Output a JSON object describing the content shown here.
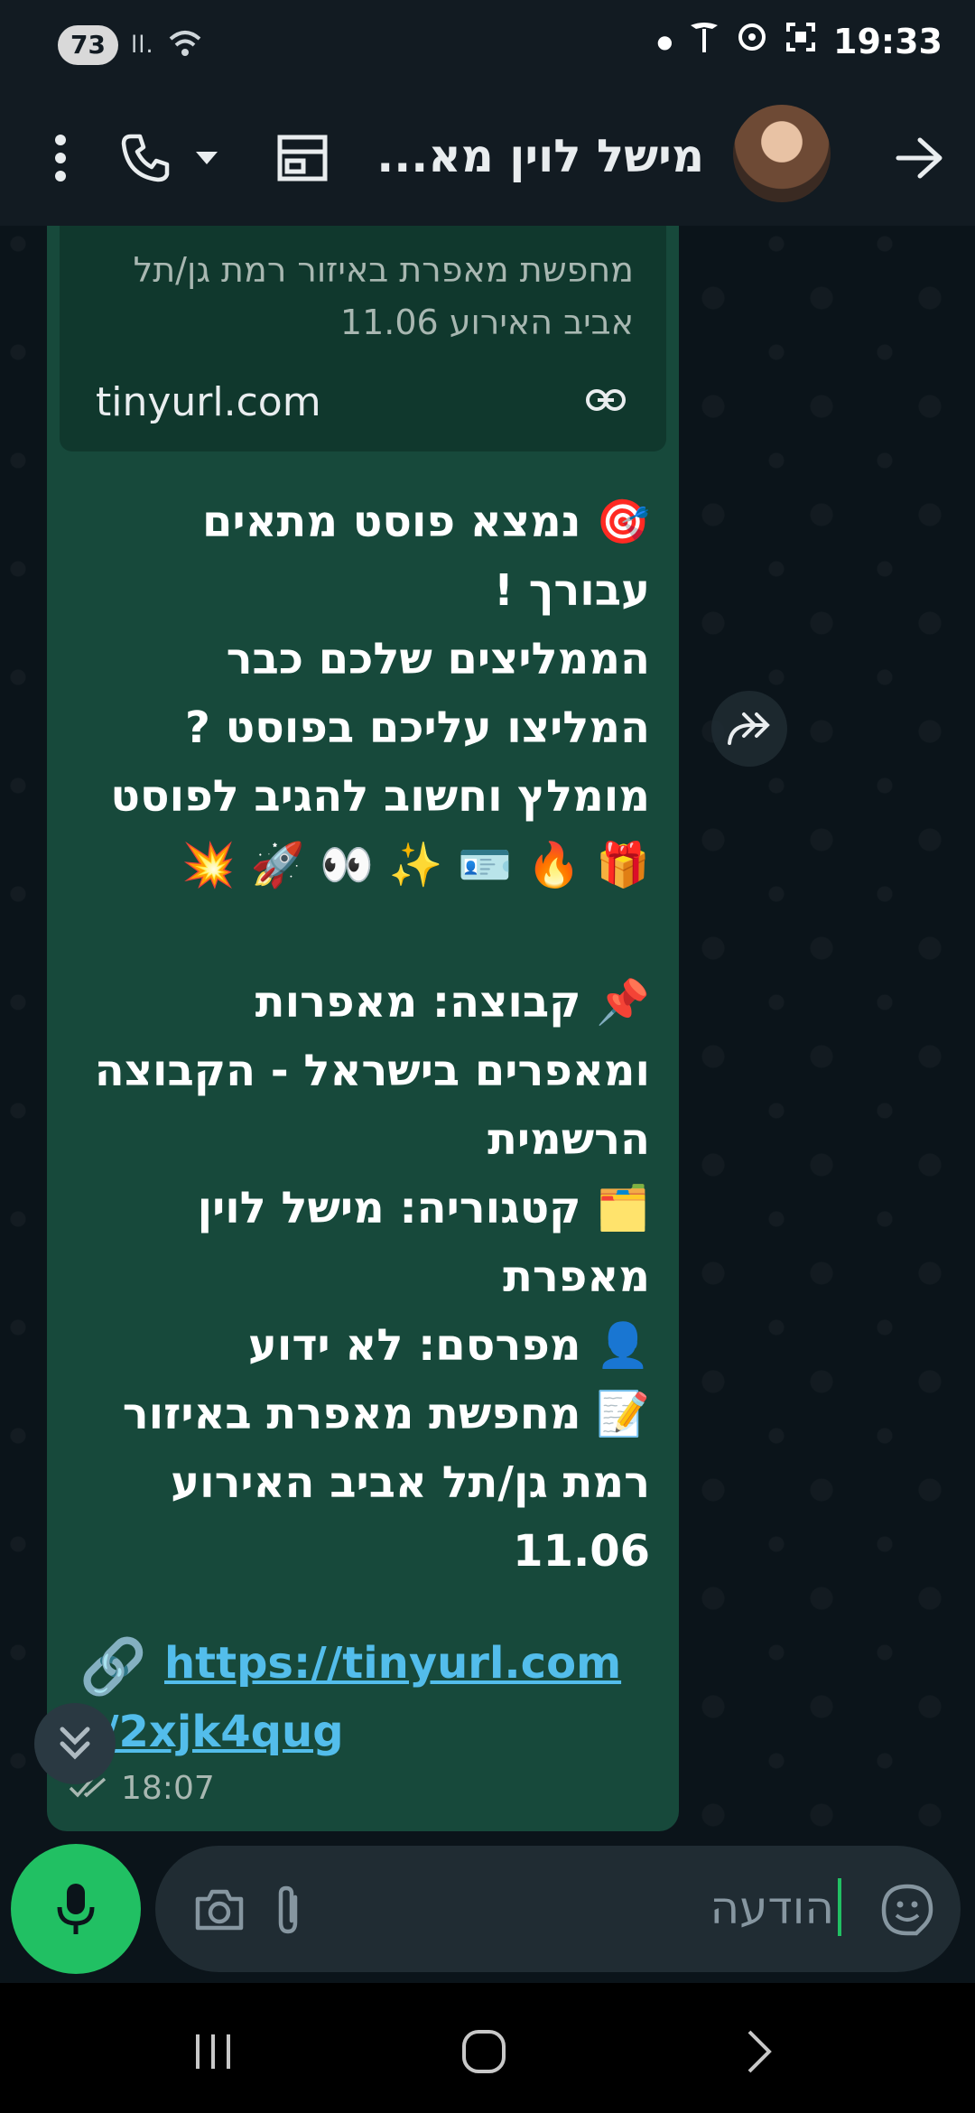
{
  "status_bar": {
    "battery": "73",
    "signal": "ll.",
    "time": "19:33"
  },
  "header": {
    "title": "מישל לוין מא...",
    "back_icon": "arrow-right-icon",
    "store_icon": "store-icon",
    "call_icon": "phone-icon",
    "menu_icon": "more-vert-icon"
  },
  "link_preview": {
    "description": "מחפשת מאפרת באיזור רמת גן/תל אביב האירוע 11.06",
    "domain": "tinyurl.com"
  },
  "message": {
    "body": "🎯 נמצא פוסט מתאים עבורך !\nהממליצים שלכם כבר המליצו עליכם בפוסט ?\nמומלץ וחשוב להגיב לפוסט\n🎁 🔥 🪪 ✨ 👀 🚀 💥\n\n📌 קבוצה: מאפרות ומאפרים בישראל - הקבוצה הרשמית\n🗂️ קטגוריה: מישל לוין מאפרת\n👤 מפרסם: לא ידוע\n📝 מחפשת מאפרת באיזור רמת גן/תל אביב האירוע 11.06",
    "url_line1": "https://tinyurl.com",
    "url_line2": "/2xjk4qug",
    "time": "18:07"
  },
  "input": {
    "placeholder": "הודעה"
  }
}
